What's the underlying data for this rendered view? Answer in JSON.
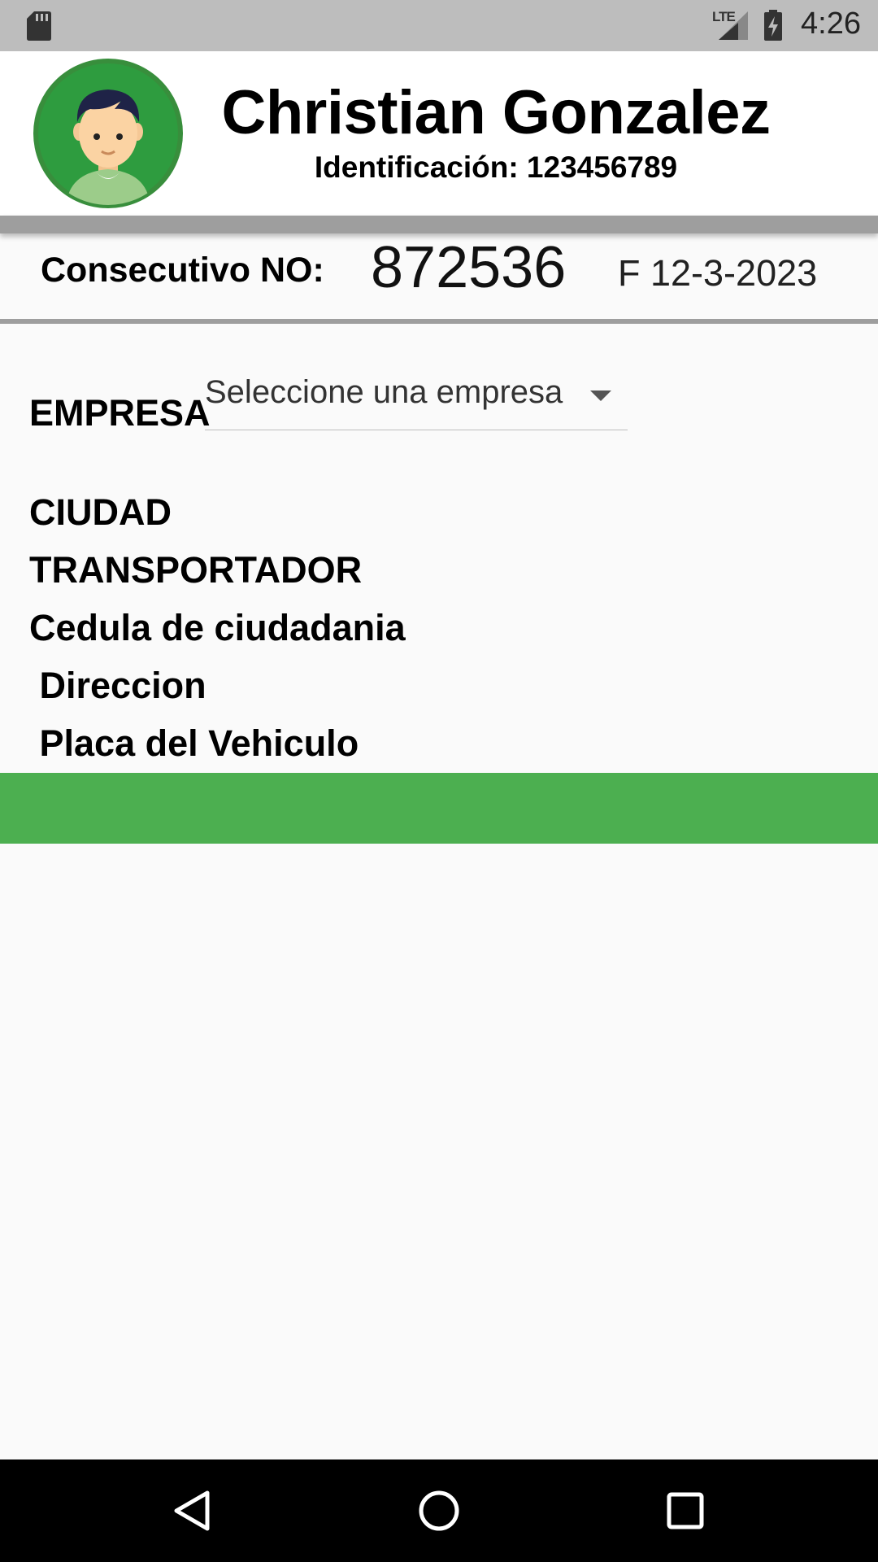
{
  "status_bar": {
    "time": "4:26",
    "network": "LTE"
  },
  "profile": {
    "name": "Christian Gonzalez",
    "identification": "Identificación: 123456789"
  },
  "consecutive": {
    "label": "Consecutivo NO:",
    "number": "872536",
    "date": "F 12-3-2023"
  },
  "form": {
    "empresa_label": "EMPRESA",
    "empresa_placeholder": "Seleccione una empresa",
    "fields": [
      "CIUDAD",
      "TRANSPORTADOR",
      "Cedula de ciudadania",
      " Direccion",
      " Placa del Vehiculo"
    ]
  },
  "colors": {
    "accent_green": "#4caf50",
    "avatar_green": "#2e9c3f",
    "status_bar": "#bdbdbd",
    "divider": "#9e9e9e"
  },
  "icons": {
    "sd_card": "sd-card-icon",
    "signal": "signal-icon",
    "battery": "battery-charging-icon",
    "avatar": "user-avatar-icon",
    "dropdown": "chevron-down-icon",
    "nav_back": "back-icon",
    "nav_home": "home-icon",
    "nav_recents": "recents-icon"
  }
}
